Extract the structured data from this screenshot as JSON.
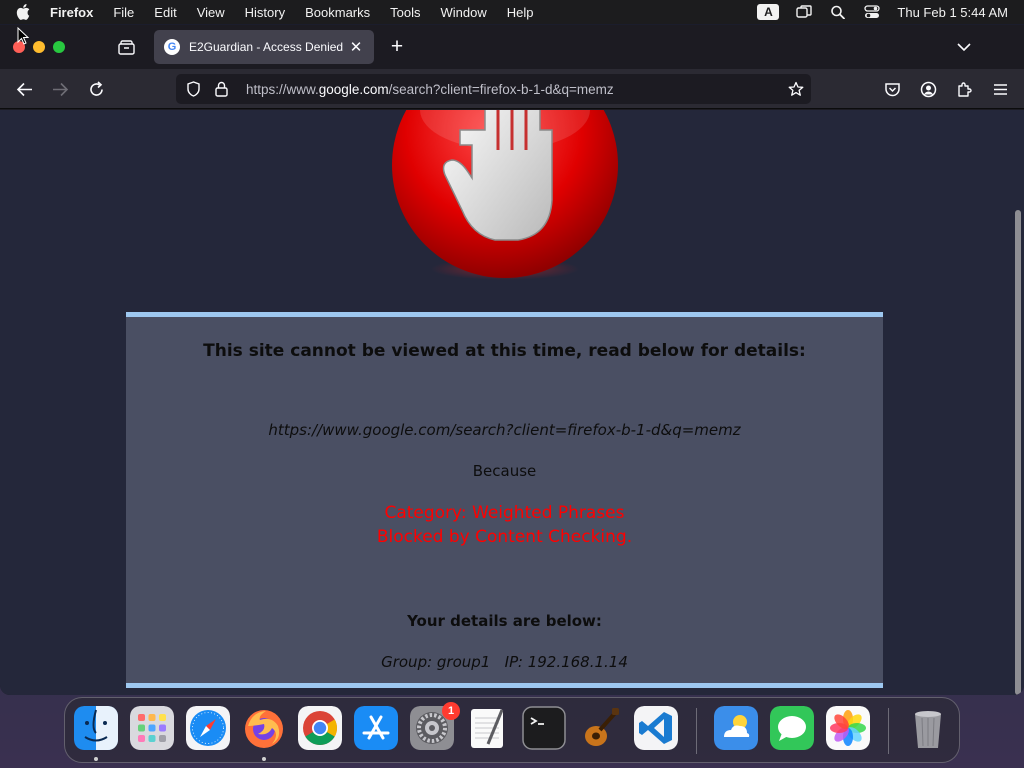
{
  "menubar": {
    "apple_icon": "apple-logo-icon",
    "app_name": "Firefox",
    "items": [
      "File",
      "Edit",
      "View",
      "History",
      "Bookmarks",
      "Tools",
      "Window",
      "Help"
    ],
    "input_badge": "A",
    "clock": "Thu Feb 1  5:44 AM"
  },
  "browser": {
    "tab": {
      "title": "E2Guardian - Access Denied",
      "favicon": "G"
    },
    "url": {
      "prefix": "https://www.",
      "host": "google.com",
      "path": "/search?client=firefox-b-1-d&q=memz"
    }
  },
  "page": {
    "heading": "This site cannot be viewed at this time, read below for details:",
    "blocked_url": "https://www.google.com/search?client=firefox-b-1-d&q=memz",
    "because": "Because",
    "reason_category": "Category: Weighted Phrases",
    "reason_detail": "Blocked by Content Checking.",
    "details_heading": "Your details are below:",
    "group": "Group: group1",
    "ip": "IP: 192.168.1.14",
    "colors": {
      "panel_background": "#4a4f63",
      "panel_border": "#9ec8f0",
      "reason_text": "#ff0000"
    }
  },
  "dock": {
    "apps": [
      {
        "name": "Finder",
        "icon": "finder-icon",
        "running": true
      },
      {
        "name": "Launchpad",
        "icon": "launchpad-icon",
        "running": false
      },
      {
        "name": "Safari",
        "icon": "safari-icon",
        "running": false
      },
      {
        "name": "Firefox",
        "icon": "firefox-icon",
        "running": true
      },
      {
        "name": "Chrome",
        "icon": "chrome-icon",
        "running": false
      },
      {
        "name": "App Store",
        "icon": "app-store-icon",
        "running": false
      },
      {
        "name": "System Settings",
        "icon": "system-settings-icon",
        "running": false,
        "badge": "1"
      },
      {
        "name": "TextEdit",
        "icon": "textedit-icon",
        "running": false
      },
      {
        "name": "Terminal",
        "icon": "terminal-icon",
        "running": false
      },
      {
        "name": "GarageBand",
        "icon": "garageband-icon",
        "running": false
      },
      {
        "name": "Visual Studio Code",
        "icon": "vscode-icon",
        "running": false
      },
      {
        "name": "Weather",
        "icon": "weather-icon",
        "running": false
      },
      {
        "name": "Messages",
        "icon": "messages-icon",
        "running": false
      },
      {
        "name": "Photos",
        "icon": "photos-icon",
        "running": false
      },
      {
        "name": "Trash",
        "icon": "trash-icon",
        "running": false
      }
    ]
  }
}
